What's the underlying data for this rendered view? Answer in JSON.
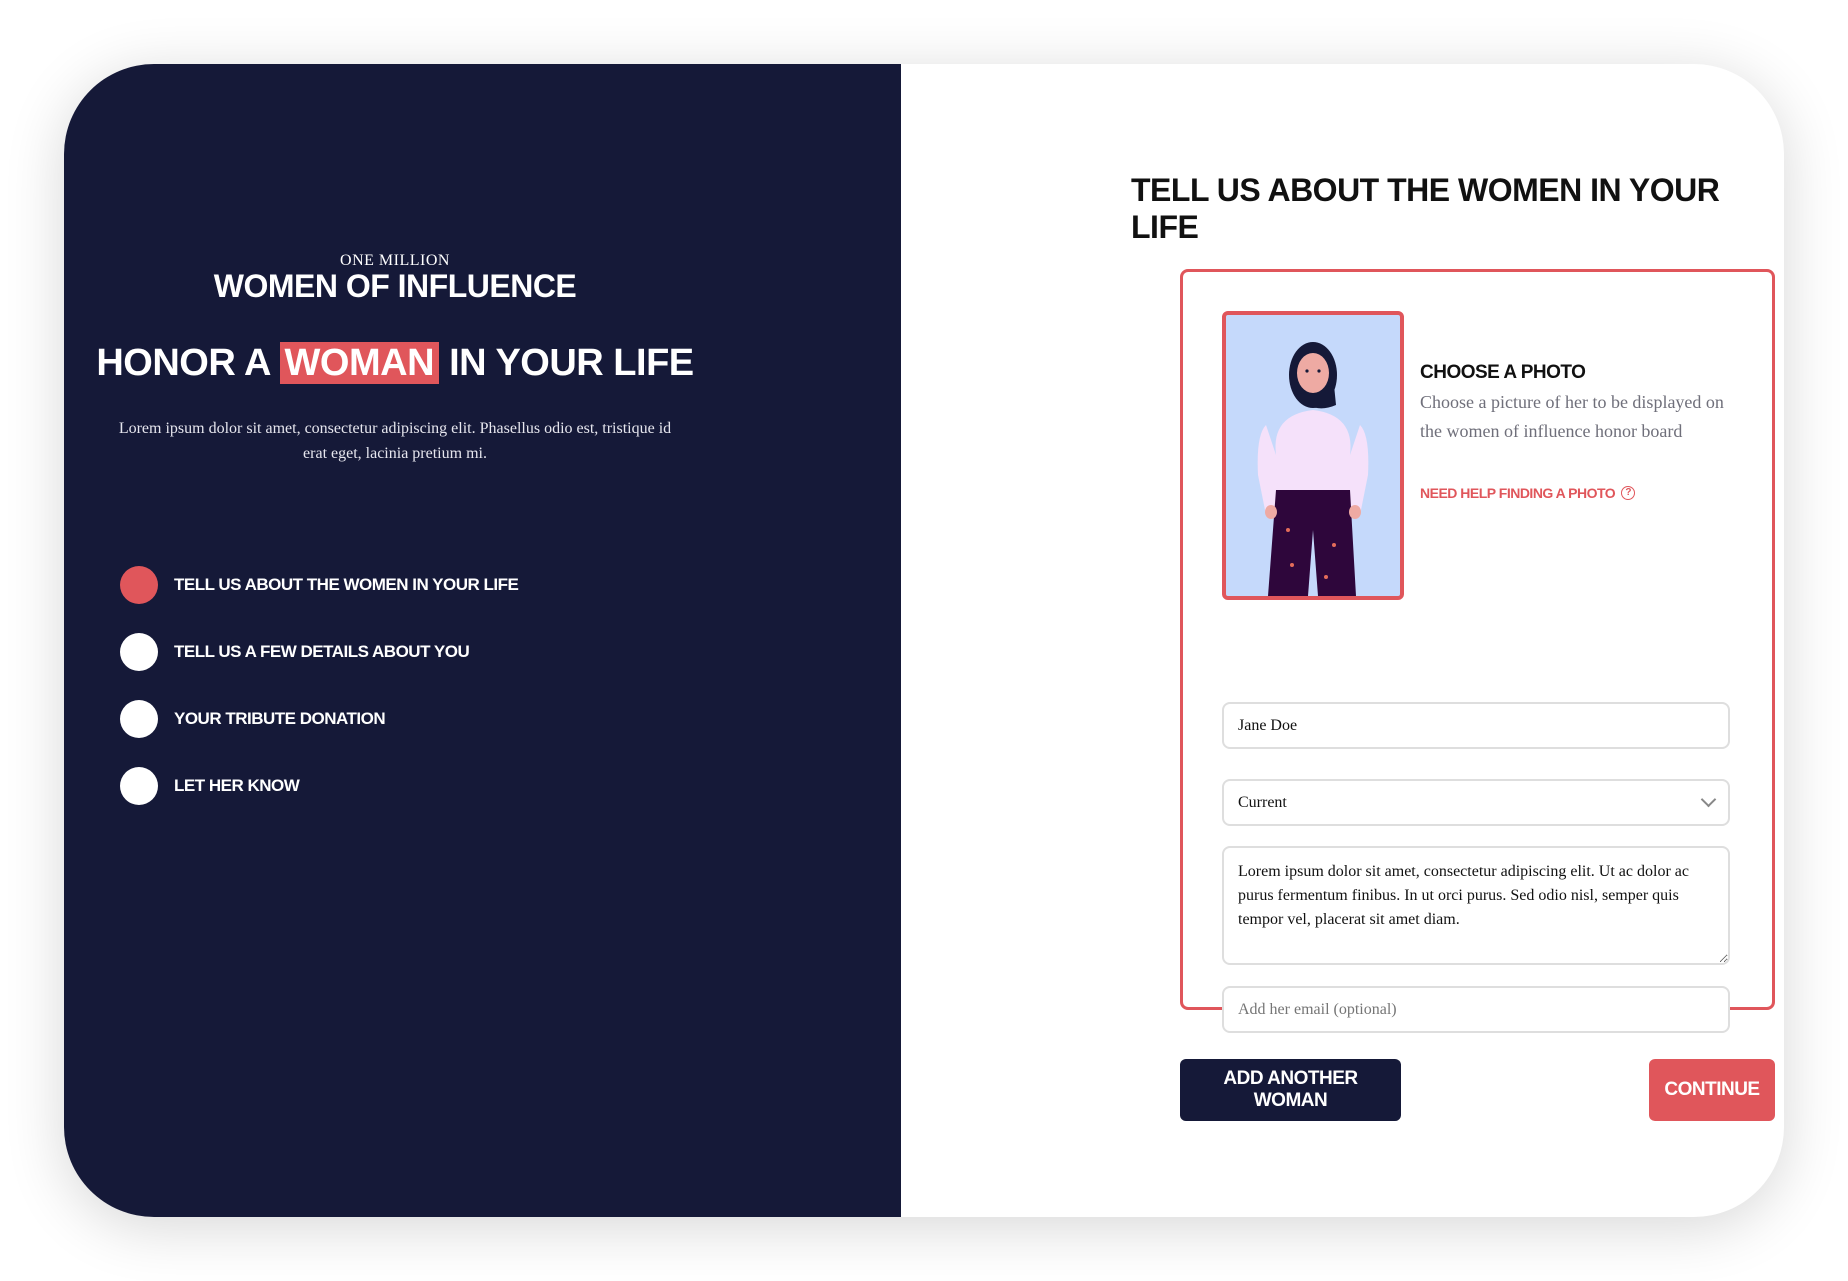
{
  "brand": {
    "top": "ONE MILLION",
    "main": "WOMEN OF INFLUENCE"
  },
  "hero": {
    "before": "HONOR A",
    "highlight": "WOMAN",
    "after": "IN YOUR LIFE"
  },
  "intro": "Lorem ipsum dolor sit amet, consectetur adipiscing elit. Phasellus odio est, tristique id erat eget, lacinia pretium mi.",
  "steps": [
    {
      "label": "TELL US ABOUT THE WOMEN IN YOUR LIFE",
      "active": true
    },
    {
      "label": "TELL US A FEW DETAILS ABOUT YOU",
      "active": false
    },
    {
      "label": "YOUR TRIBUTE DONATION",
      "active": false
    },
    {
      "label": "LET HER KNOW",
      "active": false
    }
  ],
  "form": {
    "title": "TELL US ABOUT THE WOMEN IN YOUR LIFE",
    "photo": {
      "title": "CHOOSE A PHOTO",
      "description": "Choose a picture of her to be displayed on the women of influence honor board",
      "help": "NEED HELP FINDING A PHOTO",
      "help_icon": "question-circle-icon"
    },
    "name_value": "Jane Doe",
    "status_value": "Current",
    "story_value": "Lorem ipsum dolor sit amet, consectetur adipiscing elit. Ut ac dolor ac purus fermentum finibus. In ut orci purus. Sed odio nisl, semper quis tempor vel, placerat sit amet diam.",
    "email_placeholder": "Add her email (optional)"
  },
  "buttons": {
    "add": "ADD ANOTHER WOMAN",
    "continue": "CONTINUE"
  },
  "colors": {
    "navy": "#151938",
    "accent": "#e0565b",
    "photo_bg": "#c5d9fb"
  }
}
